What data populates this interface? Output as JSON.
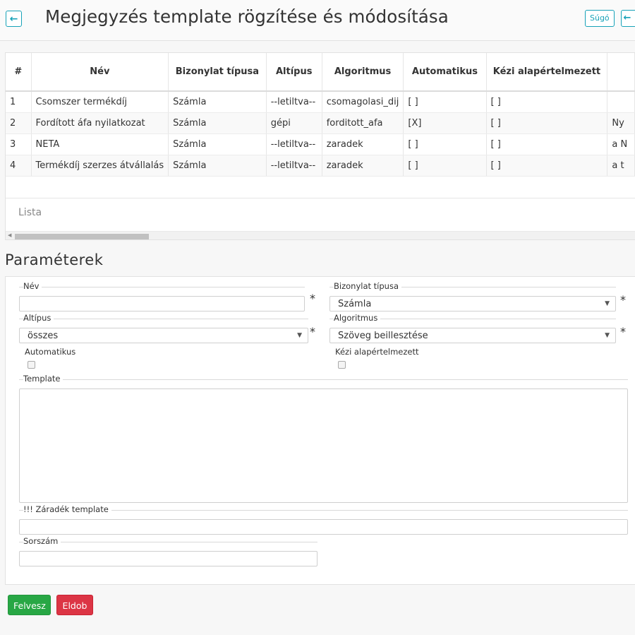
{
  "header": {
    "back_icon": "arrow-left-icon",
    "title": "Megjegyzés template rögzítése és módosítása",
    "help_label": "Súgó",
    "accent_color": "#17a2b8"
  },
  "table": {
    "columns": [
      "#",
      "Név",
      "Bizonylat típusa",
      "Altípus",
      "Algoritmus",
      "Automatikus",
      "Kézi alapértelmezett",
      ""
    ],
    "rows": [
      [
        "1",
        "Csomszer termékdíj",
        "Számla",
        "--letiltva--",
        "csomagolasi_dij",
        "[ ]",
        "[ ]",
        ""
      ],
      [
        "2",
        "Fordított áfa nyilatkozat",
        "Számla",
        "gépi",
        "forditott_afa",
        "[X]",
        "[ ]",
        "Ny"
      ],
      [
        "3",
        "NETA",
        "Számla",
        "--letiltva--",
        "zaradek",
        "[ ]",
        "[ ]",
        "a N"
      ],
      [
        "4",
        "Termékdíj szerzes átvállalás",
        "Számla",
        "--letiltva--",
        "zaradek",
        "[ ]",
        "[ ]",
        "a t"
      ]
    ],
    "footer_label": "Lista"
  },
  "params": {
    "title": "Paraméterek",
    "name_label": "Név",
    "name_value": "",
    "doc_type_label": "Bizonylat típusa",
    "doc_type_value": "Számla",
    "subtype_label": "Altípus",
    "subtype_value": "összes",
    "algorithm_label": "Algoritmus",
    "algorithm_value": "Szöveg beillesztése",
    "automatic_label": "Automatikus",
    "automatic_checked": false,
    "manual_default_label": "Kézi alapértelmezett",
    "manual_default_checked": false,
    "template_label": "Template",
    "template_value": "",
    "clause_label": "!!! Záradék template",
    "clause_value": "",
    "order_label": "Sorszám",
    "order_value": "",
    "required_mark": "*"
  },
  "actions": {
    "add_label": "Felvesz",
    "add_color": "#28a745",
    "drop_label": "Eldob",
    "drop_color": "#dc3545"
  }
}
